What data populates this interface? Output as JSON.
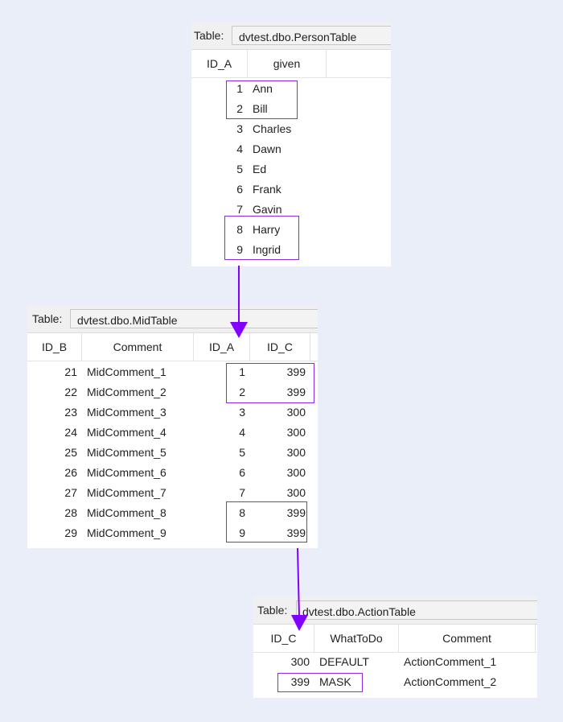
{
  "table_label": "Table:",
  "person_table": {
    "name": "dvtest.dbo.PersonTable",
    "columns": [
      "ID_A",
      "given"
    ],
    "rows": [
      [
        "1",
        "Ann"
      ],
      [
        "2",
        "Bill"
      ],
      [
        "3",
        "Charles"
      ],
      [
        "4",
        "Dawn"
      ],
      [
        "5",
        "Ed"
      ],
      [
        "6",
        "Frank"
      ],
      [
        "7",
        "Gavin"
      ],
      [
        "8",
        "Harry"
      ],
      [
        "9",
        "Ingrid"
      ]
    ]
  },
  "mid_table": {
    "name": "dvtest.dbo.MidTable",
    "columns": [
      "ID_B",
      "Comment",
      "ID_A",
      "ID_C"
    ],
    "rows": [
      [
        "21",
        "MidComment_1",
        "1",
        "399"
      ],
      [
        "22",
        "MidComment_2",
        "2",
        "399"
      ],
      [
        "23",
        "MidComment_3",
        "3",
        "300"
      ],
      [
        "24",
        "MidComment_4",
        "4",
        "300"
      ],
      [
        "25",
        "MidComment_5",
        "5",
        "300"
      ],
      [
        "26",
        "MidComment_6",
        "6",
        "300"
      ],
      [
        "27",
        "MidComment_7",
        "7",
        "300"
      ],
      [
        "28",
        "MidComment_8",
        "8",
        "399"
      ],
      [
        "29",
        "MidComment_9",
        "9",
        "399"
      ]
    ]
  },
  "action_table": {
    "name": "dvtest.dbo.ActionTable",
    "columns": [
      "ID_C",
      "WhatToDo",
      "Comment"
    ],
    "rows": [
      [
        "300",
        "DEFAULT",
        "ActionComment_1"
      ],
      [
        "399",
        "MASK",
        "ActionComment_2"
      ]
    ]
  },
  "colors": {
    "highlight": "#8a2be2",
    "arrow": "#8200ff",
    "background": "#e9eef8"
  }
}
